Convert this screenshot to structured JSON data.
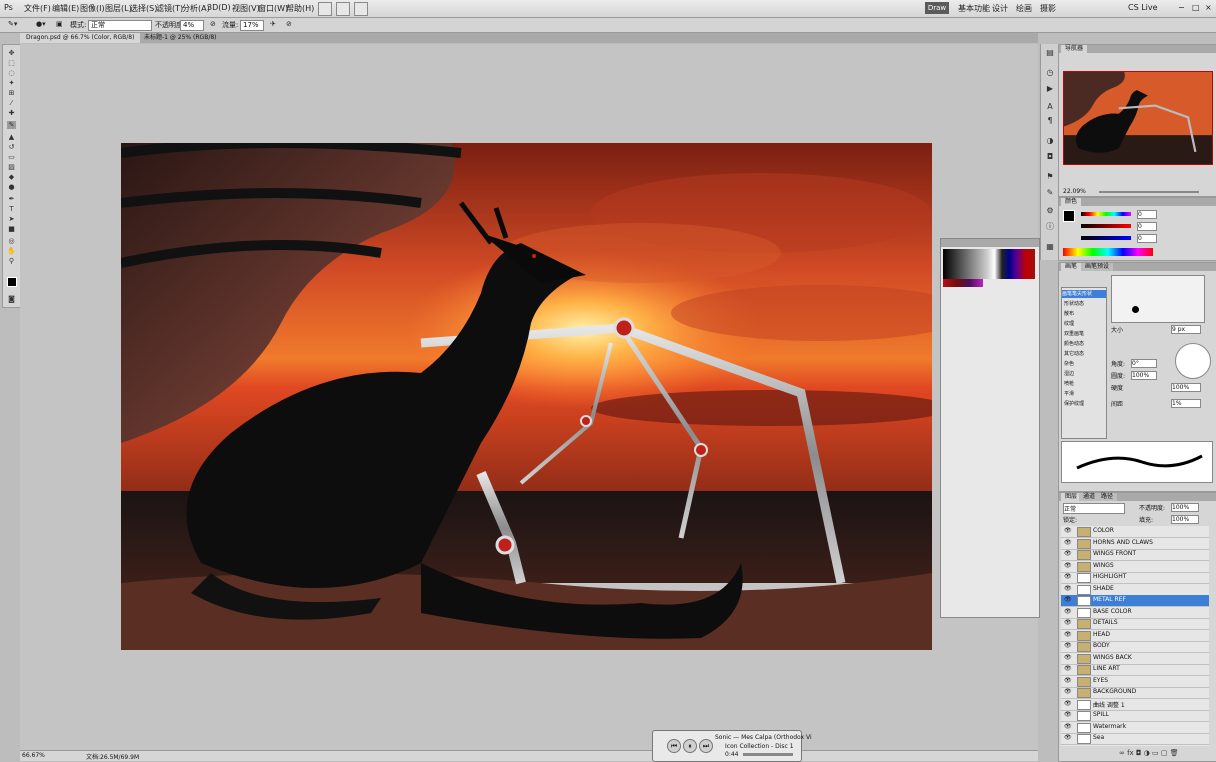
{
  "menu": {
    "items": [
      "文件(F)",
      "编辑(E)",
      "图像(I)",
      "图层(L)",
      "选择(S)",
      "滤镜(T)",
      "分析(A)",
      "3D(D)",
      "视图(V)",
      "窗口(W)",
      "帮助(H)"
    ],
    "workspace": "Draw",
    "workspaces": [
      "基本功能",
      "设计",
      "绘画",
      "摄影"
    ],
    "search": "CS Live"
  },
  "options": {
    "mode_label": "模式:",
    "mode_value": "正常",
    "opacity_label": "不透明度:",
    "opacity_value": "4%",
    "flow_label": "流量:",
    "flow_value": "17%"
  },
  "tabs": [
    {
      "label": "Dragon.psd @ 66.7% (Color, RGB/8)"
    },
    {
      "label": "未标题-1 @ 25% (RGB/8)"
    }
  ],
  "status": {
    "zoom": "66.67%",
    "doc": "文档:26.5M/69.9M"
  },
  "navigator": {
    "tab": "导航器",
    "zoom": "22.09%"
  },
  "color": {
    "tab": "颜色",
    "r": "0",
    "g": "0",
    "b": "0"
  },
  "brush": {
    "tabs": [
      "画笔",
      "画笔预设"
    ],
    "items": [
      "画笔笔尖形状",
      "形状动态",
      "散布",
      "纹理",
      "双重画笔",
      "颜色动态",
      "其它动态",
      "杂色",
      "湿边",
      "喷枪",
      "平滑",
      "保护纹理"
    ],
    "size": "9 px",
    "angle": "0°",
    "roundness": "100%",
    "hardness": "100%",
    "spacing": "1%"
  },
  "layers": {
    "tabs": [
      "图层",
      "通道",
      "路径"
    ],
    "blend": "正常",
    "opacity": "100%",
    "fill": "100%",
    "rows": [
      {
        "name": "COLOR",
        "type": "group"
      },
      {
        "name": "HORNS AND CLAWS",
        "type": "group"
      },
      {
        "name": "WINGS FRONT",
        "type": "group"
      },
      {
        "name": "WINGS",
        "type": "group"
      },
      {
        "name": "HIGHLIGHT",
        "type": "layer"
      },
      {
        "name": "SHADE",
        "type": "layer"
      },
      {
        "name": "METAL REF",
        "type": "layer",
        "selected": true
      },
      {
        "name": "BASE COLOR",
        "type": "layer"
      },
      {
        "name": "DETAILS",
        "type": "group"
      },
      {
        "name": "HEAD",
        "type": "group"
      },
      {
        "name": "BODY",
        "type": "group"
      },
      {
        "name": "WINGS BACK",
        "type": "group"
      },
      {
        "name": "LINE ART",
        "type": "group"
      },
      {
        "name": "EYES",
        "type": "group"
      },
      {
        "name": "BACKGROUND",
        "type": "group"
      },
      {
        "name": "曲线 调整 1",
        "type": "adjust"
      },
      {
        "name": "SPILL",
        "type": "layer"
      },
      {
        "name": "Watermark",
        "type": "layer"
      },
      {
        "name": "Sea",
        "type": "layer"
      }
    ]
  },
  "media": {
    "track": "Sonic — Mes Calpa (Orthodox Vi",
    "sub": "Icon Collection - Disc 1",
    "time": "0:44"
  },
  "colors": {
    "canvas_bg": "#c4c4c4",
    "selected_row": "#3d7fd6"
  }
}
